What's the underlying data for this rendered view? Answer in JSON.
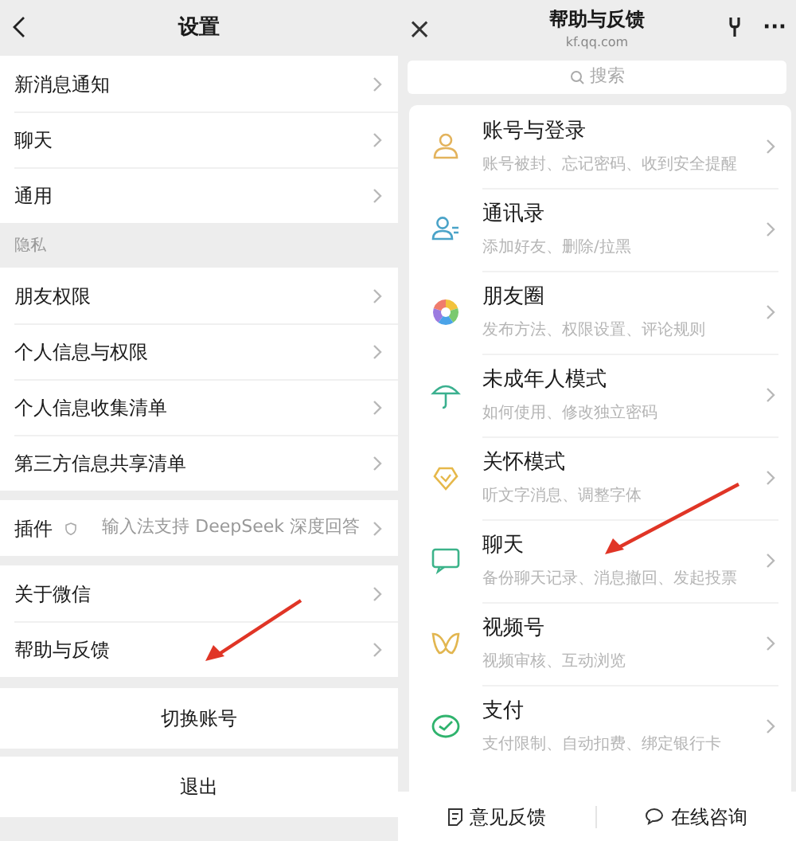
{
  "settings": {
    "title": "设置",
    "groups": [
      {
        "items": [
          {
            "label": "新消息通知",
            "pointed": false
          },
          {
            "label": "聊天",
            "pointed": false
          },
          {
            "label": "通用",
            "pointed": false
          }
        ]
      },
      {
        "label": "隐私",
        "items": [
          {
            "label": "朋友权限",
            "pointed": false
          },
          {
            "label": "个人信息与权限",
            "pointed": false
          },
          {
            "label": "个人信息收集清单",
            "pointed": false
          },
          {
            "label": "第三方信息共享清单",
            "pointed": false
          }
        ]
      },
      {
        "items": [
          {
            "label": "插件",
            "value": "输入法支持 DeepSeek 深度回答",
            "pointed": false
          }
        ]
      },
      {
        "items": [
          {
            "label": "关于微信",
            "pointed": false
          },
          {
            "label": "帮助与反馈",
            "pointed": true
          }
        ]
      }
    ],
    "actions": [
      "切换账号",
      "退出"
    ]
  },
  "help": {
    "title": "帮助与反馈",
    "subtitle": "kf.qq.com",
    "close": "×",
    "more": "···",
    "search": {
      "placeholder": "搜索"
    },
    "topics": [
      {
        "kind": "person",
        "title": "账号与登录",
        "desc": "账号被封、忘记密码、收到安全提醒",
        "pointed": false
      },
      {
        "kind": "contacts",
        "title": "通讯录",
        "desc": "添加好友、删除/拉黑",
        "pointed": false
      },
      {
        "kind": "moments",
        "title": "朋友圈",
        "desc": "发布方法、权限设置、评论规则",
        "pointed": false
      },
      {
        "kind": "umbrella",
        "title": "未成年人模式",
        "desc": "如何使用、修改独立密码",
        "pointed": false
      },
      {
        "kind": "care",
        "title": "关怀模式",
        "desc": "听文字消息、调整字体",
        "pointed": false
      },
      {
        "kind": "chat",
        "title": "聊天",
        "desc": "备份聊天记录、消息撤回、发起投票",
        "pointed": true
      },
      {
        "kind": "video",
        "title": "视频号",
        "desc": "视频审核、互动浏览",
        "pointed": false
      },
      {
        "kind": "pay",
        "title": "支付",
        "desc": "支付限制、自动扣费、绑定银行卡",
        "pointed": false
      }
    ],
    "bottom_buttons": [
      {
        "kind": "feedback",
        "label": "意见反馈"
      },
      {
        "kind": "consult",
        "label": "在线咨询"
      }
    ]
  }
}
